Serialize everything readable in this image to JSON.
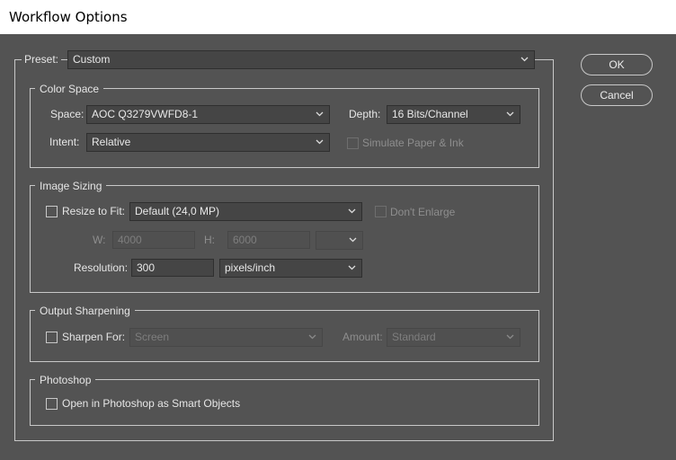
{
  "window": {
    "title": "Workflow Options"
  },
  "preset": {
    "label": "Preset:",
    "value": "Custom"
  },
  "buttons": {
    "ok": "OK",
    "cancel": "Cancel"
  },
  "color_space": {
    "legend": "Color Space",
    "space_label": "Space:",
    "space_value": "AOC Q3279VWFD8-1",
    "depth_label": "Depth:",
    "depth_value": "16 Bits/Channel",
    "intent_label": "Intent:",
    "intent_value": "Relative",
    "simulate_label": "Simulate Paper & Ink"
  },
  "image_sizing": {
    "legend": "Image Sizing",
    "resize_label": "Resize to Fit:",
    "resize_value": "Default  (24,0 MP)",
    "dont_enlarge_label": "Don't Enlarge",
    "w_label": "W:",
    "w_value": "4000",
    "h_label": "H:",
    "h_value": "6000",
    "unit_value": "",
    "resolution_label": "Resolution:",
    "resolution_value": "300",
    "resolution_unit": "pixels/inch"
  },
  "output_sharpening": {
    "legend": "Output Sharpening",
    "sharpen_label": "Sharpen For:",
    "sharpen_value": "Screen",
    "amount_label": "Amount:",
    "amount_value": "Standard"
  },
  "photoshop": {
    "legend": "Photoshop",
    "smart_objects_label": "Open in Photoshop as Smart Objects"
  }
}
